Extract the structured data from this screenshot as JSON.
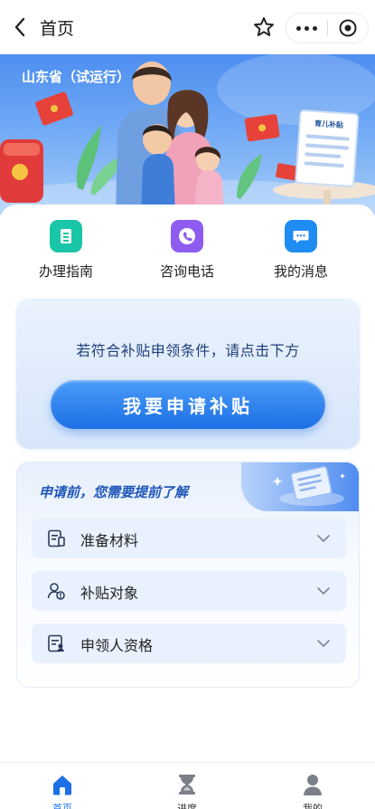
{
  "nav": {
    "title": "首页"
  },
  "banner": {
    "province": "山东省（试运行）",
    "doc_label": "育儿补贴"
  },
  "quick_actions": [
    {
      "label": "办理指南",
      "icon": "guide-icon",
      "color": "#19c6a8"
    },
    {
      "label": "咨询电话",
      "icon": "phone-icon",
      "color": "#8f5cf0"
    },
    {
      "label": "我的消息",
      "icon": "message-icon",
      "color": "#1f8cf2"
    }
  ],
  "apply": {
    "hint": "若符合补贴申领条件，请点击下方",
    "button_label": "我要申请补贴"
  },
  "know": {
    "title": "申请前，您需要提前了解",
    "items": [
      {
        "label": "准备材料",
        "icon": "materials-icon"
      },
      {
        "label": "补贴对象",
        "icon": "recipient-icon"
      },
      {
        "label": "申领人资格",
        "icon": "eligibility-icon"
      }
    ]
  },
  "tabs": [
    {
      "label": "首页",
      "icon": "home-icon",
      "active": true
    },
    {
      "label": "进度",
      "icon": "hourglass-icon",
      "active": false
    },
    {
      "label": "我的",
      "icon": "user-icon",
      "active": false
    }
  ],
  "colors": {
    "accent": "#1d6fe6",
    "banner_top": "#4d8ef0"
  }
}
